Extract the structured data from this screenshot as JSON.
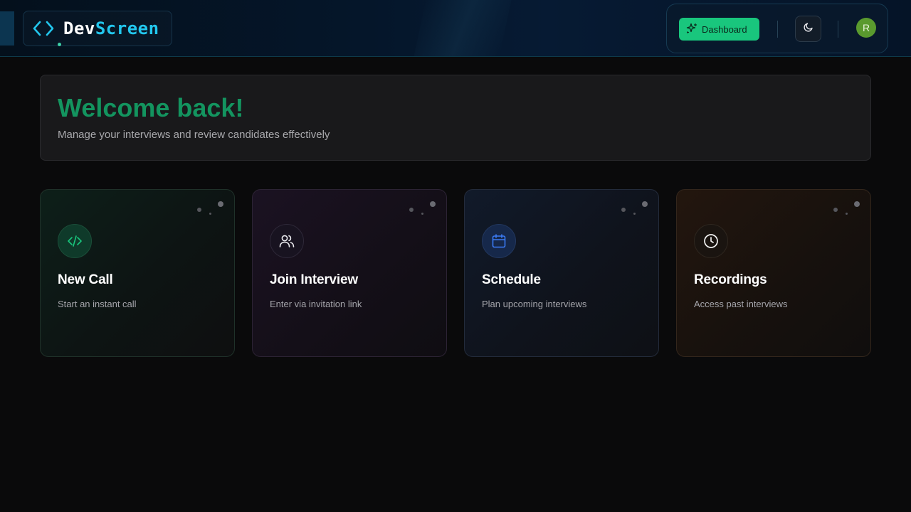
{
  "header": {
    "logo": {
      "part1": "Dev",
      "part2": "Screen",
      "icon": "code-brackets-icon"
    },
    "dashboard_button": {
      "label": "Dashboard",
      "icon": "sparkles-icon"
    },
    "theme_toggle": {
      "icon": "moon-icon"
    },
    "avatar": {
      "initial": "R"
    }
  },
  "welcome": {
    "title": "Welcome back!",
    "subtitle": "Manage your interviews and review candidates effectively"
  },
  "cards": [
    {
      "title": "New Call",
      "subtitle": "Start an instant call",
      "icon": "code-icon",
      "accent": "#19c67d"
    },
    {
      "title": "Join Interview",
      "subtitle": "Enter via invitation link",
      "icon": "users-icon",
      "accent": "#e0e0e6"
    },
    {
      "title": "Schedule",
      "subtitle": "Plan upcoming interviews",
      "icon": "calendar-icon",
      "accent": "#3b7bf5"
    },
    {
      "title": "Recordings",
      "subtitle": "Access past interviews",
      "icon": "clock-icon",
      "accent": "#f2f2f2"
    }
  ],
  "colors": {
    "brand_green": "#19c67d",
    "brand_cyan": "#22c7ee",
    "welcome_title": "#13945f",
    "background": "#0a0a0b"
  }
}
